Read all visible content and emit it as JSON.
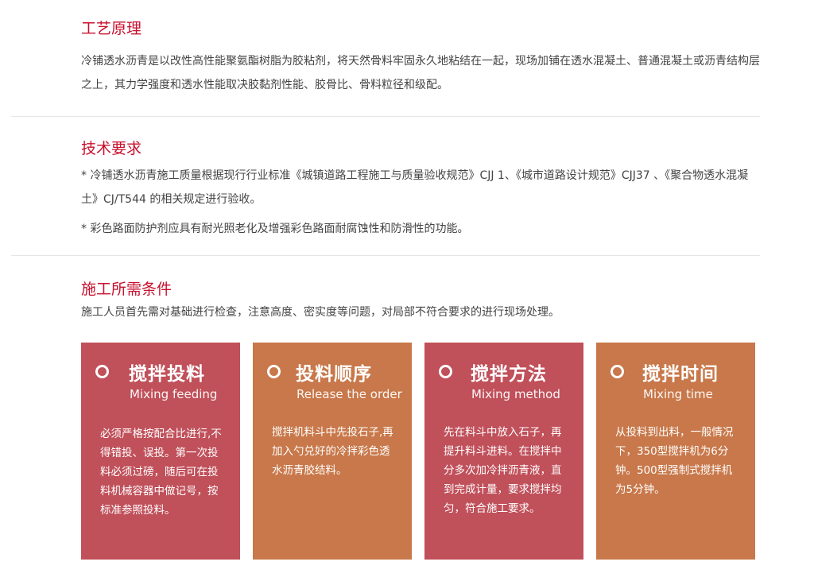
{
  "sections": {
    "principle": {
      "title": "工艺原理",
      "paragraph": "冷铺透水沥青是以改性高性能聚氨酯树脂为胶粘剂，将天然骨料牢固永久地粘结在一起，现场加铺在透水混凝土、普通混凝土或沥青结构层之上，其力学强度和透水性能取决胶黏剂性能、胶骨比、骨料粒径和级配。"
    },
    "requirements": {
      "title": "技术要求",
      "items": [
        "* 冷铺透水沥青施工质量根据现行行业标准《城镇道路工程施工与质量验收规范》CJJ 1、《城市道路设计规范》CJJ37 、《聚合物透水混凝土》CJ/T544 的相关规定进行验收。",
        "* 彩色路面防护剂应具有耐光照老化及增强彩色路面耐腐蚀性和防滑性的功能。"
      ]
    },
    "conditions": {
      "title": "施工所需条件",
      "paragraph": "施工人员首先需对基础进行检查，注意高度、密实度等问题，对局部不符合要求的进行现场处理。"
    }
  },
  "cards": [
    {
      "title": "搅拌投料",
      "subtitle": "Mixing feeding",
      "text": "必须严格按配合比进行,不得错投、误投。第一次投料必须过磅，随后可在投料机械容器中做记号，按标准参照投料。",
      "color": "#c0505a"
    },
    {
      "title": "投料顺序",
      "subtitle": "Release the order",
      "text": "搅拌机料斗中先投石子,再加入勺兑好的冷拌彩色透水沥青胶结料。",
      "color": "#c8784a"
    },
    {
      "title": "搅拌方法",
      "subtitle": "Mixing method",
      "text": "先在料斗中放入石子，再提升料斗进料。在搅拌中分多次加冷拌沥青液，直到完成计量，要求搅拌均匀，符合施工要求。",
      "color": "#c0505a"
    },
    {
      "title": "搅拌时间",
      "subtitle": "Mixing time",
      "text": "从投料到出料，一般情况下，350型搅拌机为6分钟。500型强制式搅拌机为5分钟。",
      "color": "#c8784a"
    }
  ]
}
